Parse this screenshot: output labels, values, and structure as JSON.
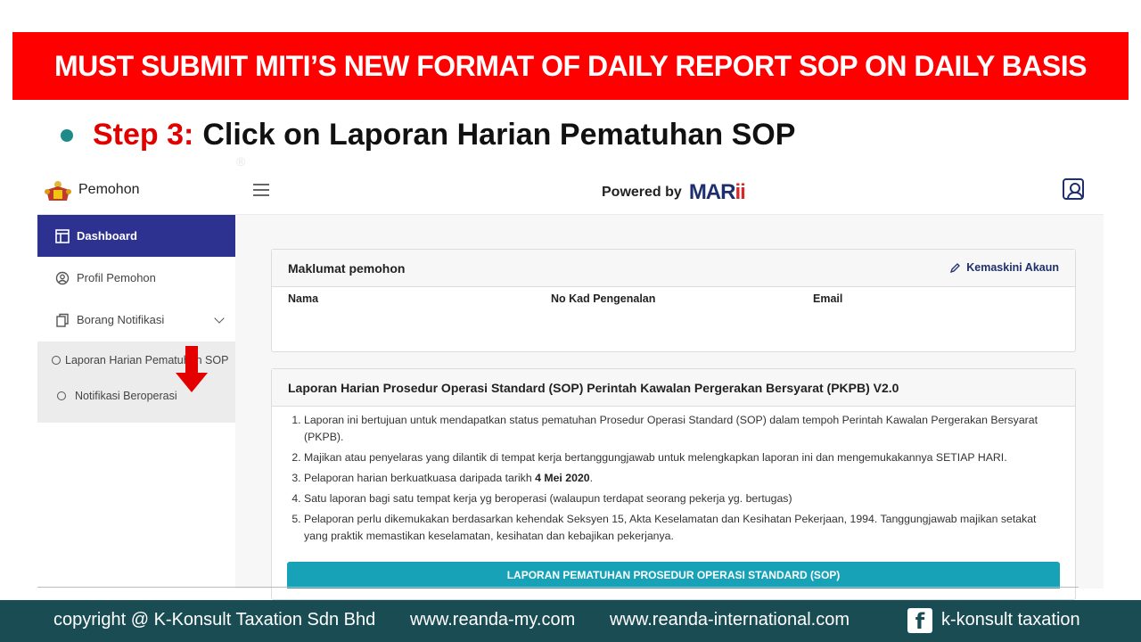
{
  "banner": {
    "title": "MUST SUBMIT MITI’S NEW FORMAT OF DAILY REPORT SOP ON DAILY BASIS",
    "bg": "#ff0000"
  },
  "step": {
    "label": "Step 3:",
    "text": "Click on Laporan Harian Pematuhan SOP"
  },
  "app": {
    "brand": "Pemohon",
    "powered_by": "Powered by",
    "logo_main": "MAR",
    "logo_accent": "ii",
    "sidebar": {
      "dashboard": "Dashboard",
      "profil": "Profil Pemohon",
      "borang": "Borang Notifikasi",
      "sub_laporan": "Laporan Harian Pematuhan SOP",
      "sub_notifikasi": "Notifikasi Beroperasi"
    },
    "info_card": {
      "title": "Maklumat pemohon",
      "edit": "Kemaskini Akaun",
      "col_nama": "Nama",
      "col_ic": "No Kad Pengenalan",
      "col_email": "Email"
    },
    "sop_card": {
      "title": "Laporan Harian Prosedur Operasi Standard (SOP) Perintah Kawalan Pergerakan Bersyarat (PKPB) V2.0",
      "rule1": "Laporan ini bertujuan untuk mendapatkan status pematuhan Prosedur Operasi Standard (SOP) dalam tempoh Perintah Kawalan Pergerakan Bersyarat (PKPB).",
      "rule2": "Majikan atau penyelaras yang dilantik di tempat kerja bertanggungjawab untuk melengkapkan laporan ini dan mengemukakannya SETIAP HARI.",
      "rule3_pre": "Pelaporan harian berkuatkuasa daripada tarikh ",
      "rule3_date": "4 Mei 2020",
      "rule3_post": ".",
      "rule4": "Satu laporan bagi satu tempat kerja yg beroperasi (walaupun terdapat seorang pekerja yg. bertugas)",
      "rule5": "Pelaporan perlu dikemukakan berdasarkan kehendak Seksyen 15, Akta Keselamatan dan Kesihatan Pekerjaan, 1994. Tanggungjawab majikan setakat yang praktik memastikan keselamatan, kesihatan dan kebajikan pekerjanya.",
      "button": "LAPORAN PEMATUHAN PROSEDUR OPERASI STANDARD (SOP)"
    }
  },
  "footer": {
    "copyright": "copyright @ K-Konsult Taxation Sdn Bhd",
    "site1": "www.reanda-my.com",
    "site2": "www.reanda-international.com",
    "fb_glyph": "f",
    "fb_name": "k-konsult taxation"
  },
  "colors": {
    "teal_footer": "#1a4c54",
    "nav_active": "#2d3290",
    "button": "#17a2b8"
  },
  "icons": [
    "crest-icon",
    "hamburger-icon",
    "user-icon",
    "dashboard-icon",
    "profile-icon",
    "document-icon",
    "chevron-down-icon",
    "red-arrow-icon",
    "pencil-icon",
    "facebook-icon"
  ]
}
